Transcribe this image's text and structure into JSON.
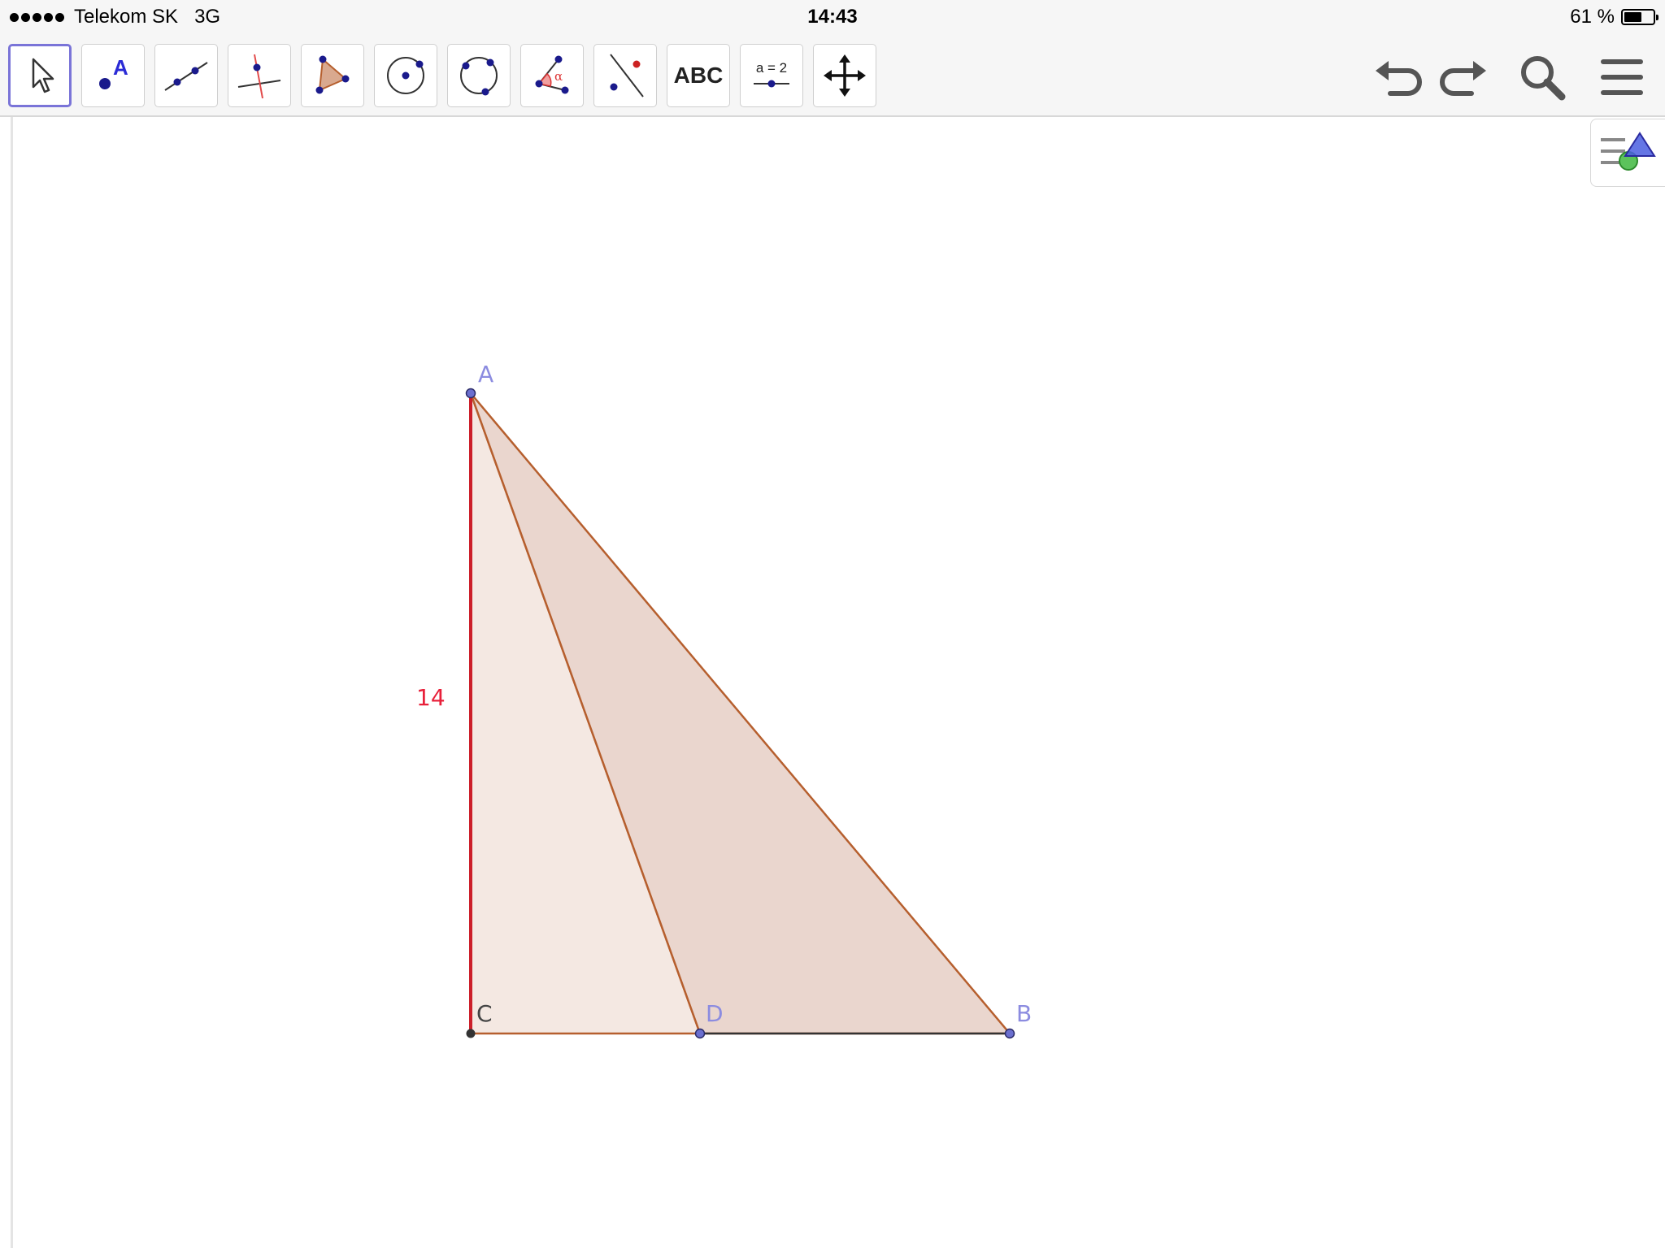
{
  "status_bar": {
    "carrier": "Telekom SK",
    "network": "3G",
    "time": "14:43",
    "battery_text": "61 %",
    "battery_level": 0.61
  },
  "toolbar": {
    "tools": [
      {
        "name": "move-tool",
        "icon": "arrow-pointer-icon",
        "selected": true
      },
      {
        "name": "point-tool",
        "icon": "point-icon",
        "label": "A"
      },
      {
        "name": "line-tool",
        "icon": "line-through-points-icon"
      },
      {
        "name": "perpendicular-line-tool",
        "icon": "perpendicular-line-icon"
      },
      {
        "name": "polygon-tool",
        "icon": "polygon-icon"
      },
      {
        "name": "circle-tool",
        "icon": "circle-center-point-icon"
      },
      {
        "name": "circle-three-points-tool",
        "icon": "circle-three-points-icon"
      },
      {
        "name": "angle-tool",
        "icon": "angle-icon",
        "label": "α"
      },
      {
        "name": "reflect-tool",
        "icon": "reflect-about-line-icon"
      },
      {
        "name": "text-tool",
        "icon": "text-icon",
        "label": "ABC"
      },
      {
        "name": "slider-tool",
        "icon": "slider-icon",
        "label": "a = 2"
      },
      {
        "name": "move-graphics-view-tool",
        "icon": "move-arrows-icon"
      }
    ],
    "right": [
      {
        "name": "undo-button",
        "icon": "undo-icon"
      },
      {
        "name": "redo-button",
        "icon": "redo-icon"
      },
      {
        "name": "search-button",
        "icon": "search-icon"
      },
      {
        "name": "menu-button",
        "icon": "hamburger-menu-icon"
      }
    ]
  },
  "algebra_toggle": {
    "icon": "algebra-view-icon"
  },
  "construction": {
    "points": [
      {
        "label": "A"
      },
      {
        "label": "B"
      },
      {
        "label": "C"
      },
      {
        "label": "D"
      }
    ],
    "segment_label": "14",
    "colors": {
      "polygon_stroke": "#b65f2e",
      "polygon_fill_light": "#f4e8e2",
      "polygon_fill_dark": "#ead6ce",
      "highlight_segment": "#cc1f2a",
      "free_point": "#6b6fcf",
      "fixed_point": "#333333",
      "label_free": "#8c8ce0",
      "label_fixed": "#444444",
      "measure_label": "#e8203a"
    }
  }
}
